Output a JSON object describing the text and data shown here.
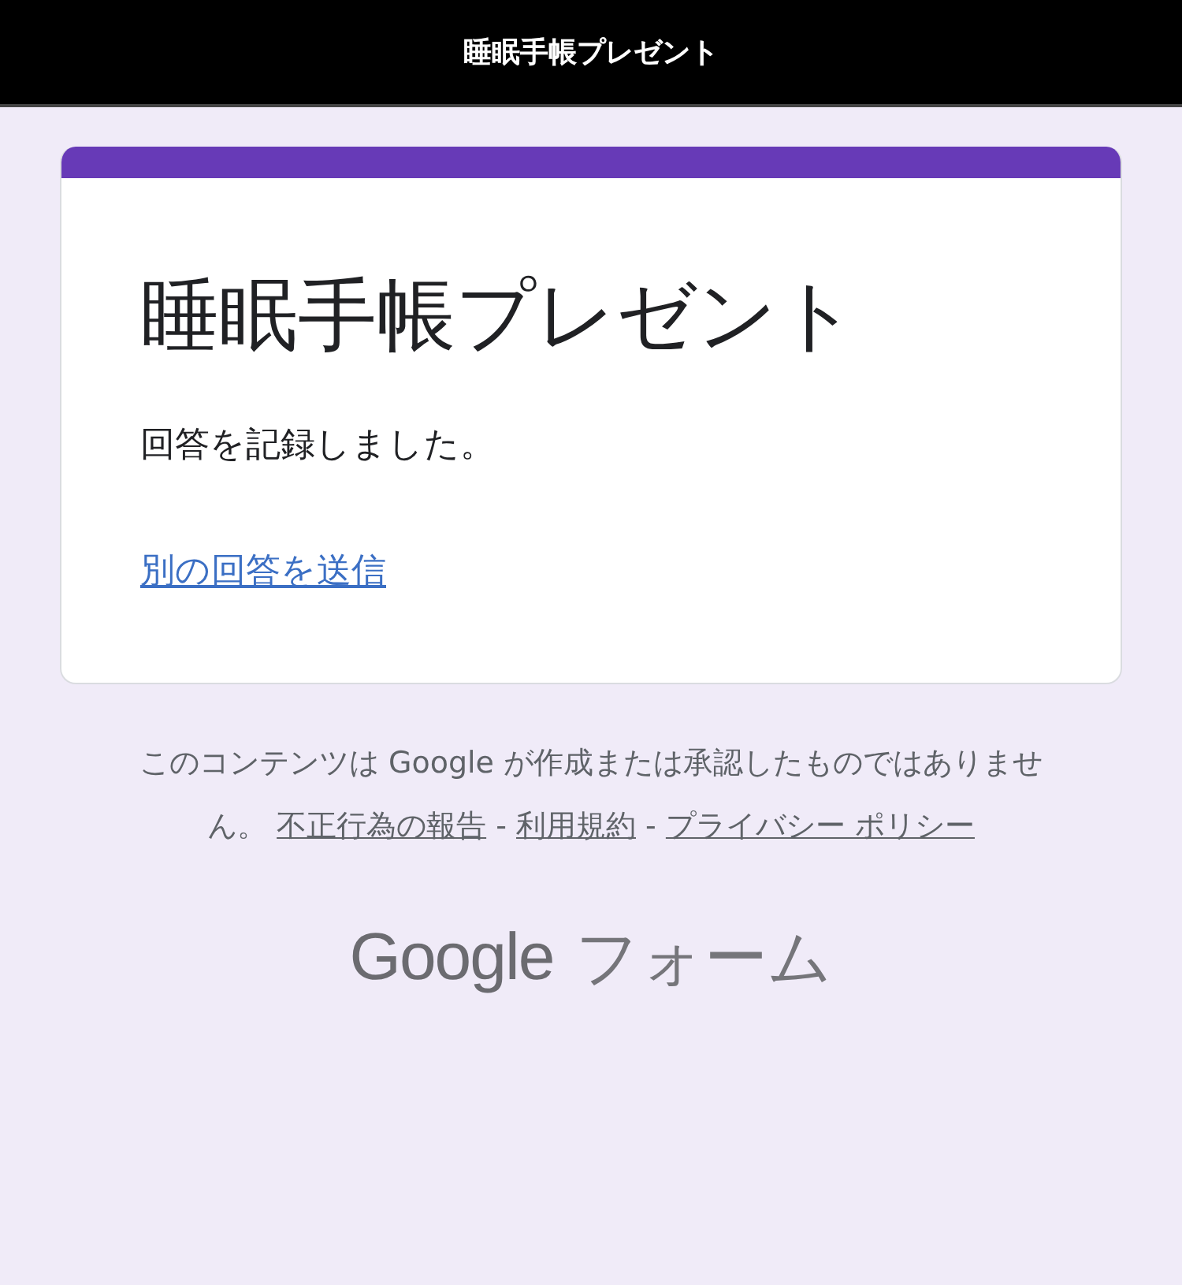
{
  "header": {
    "title": "睡眠手帳プレゼント"
  },
  "card": {
    "title": "睡眠手帳プレゼント",
    "message": "回答を記録しました。",
    "link": "別の回答を送信"
  },
  "footer": {
    "notice": "このコンテンツは Google が作成または承認したものではありません。",
    "links": [
      {
        "label": "不正行為の報告"
      },
      {
        "label": "利用規約"
      },
      {
        "label": "プライバシー ポリシー"
      }
    ],
    "separators": [
      "-",
      "-"
    ]
  },
  "brand": {
    "logo": "Google",
    "product": "フォーム"
  }
}
